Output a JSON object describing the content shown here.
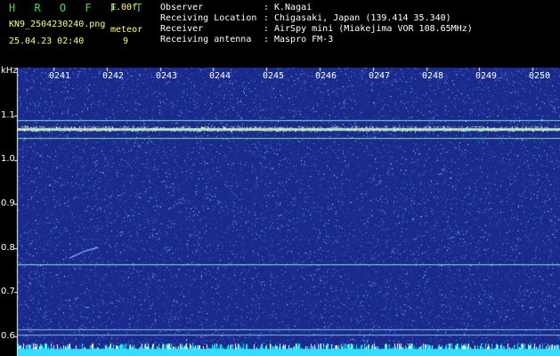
{
  "header": {
    "program_name": "H R O F F T",
    "version": "1.00f",
    "filename": "KN9_2504230240.png",
    "meteor_label": "meteor",
    "datetime": "25.04.23 02:40",
    "meteor_count": "9"
  },
  "info": [
    {
      "label": "Observer",
      "value": "K.Nagai"
    },
    {
      "label": "Receiving Location",
      "value": "Chigasaki, Japan (139.414 35.340)"
    },
    {
      "label": "Receiver",
      "value": "AirSpy mini (Miakejima VOR 108.65MHz)"
    },
    {
      "label": "Receiving antenna",
      "value": "Maspro FM-3"
    }
  ],
  "spectrogram": {
    "y_unit": "kHz",
    "y_ticks": [
      "1.1",
      "1.0",
      "0.9",
      "0.8",
      "0.7",
      "0.6"
    ],
    "x_ticks": [
      "0241",
      "0242",
      "0243",
      "0244",
      "0245",
      "0246",
      "0247",
      "0248",
      "0249",
      "0250"
    ],
    "colors": {
      "background": "#1a2a8a",
      "noise": "#4a7aff",
      "signal": "#ccffcc",
      "baseline": "#33ddff"
    }
  }
}
